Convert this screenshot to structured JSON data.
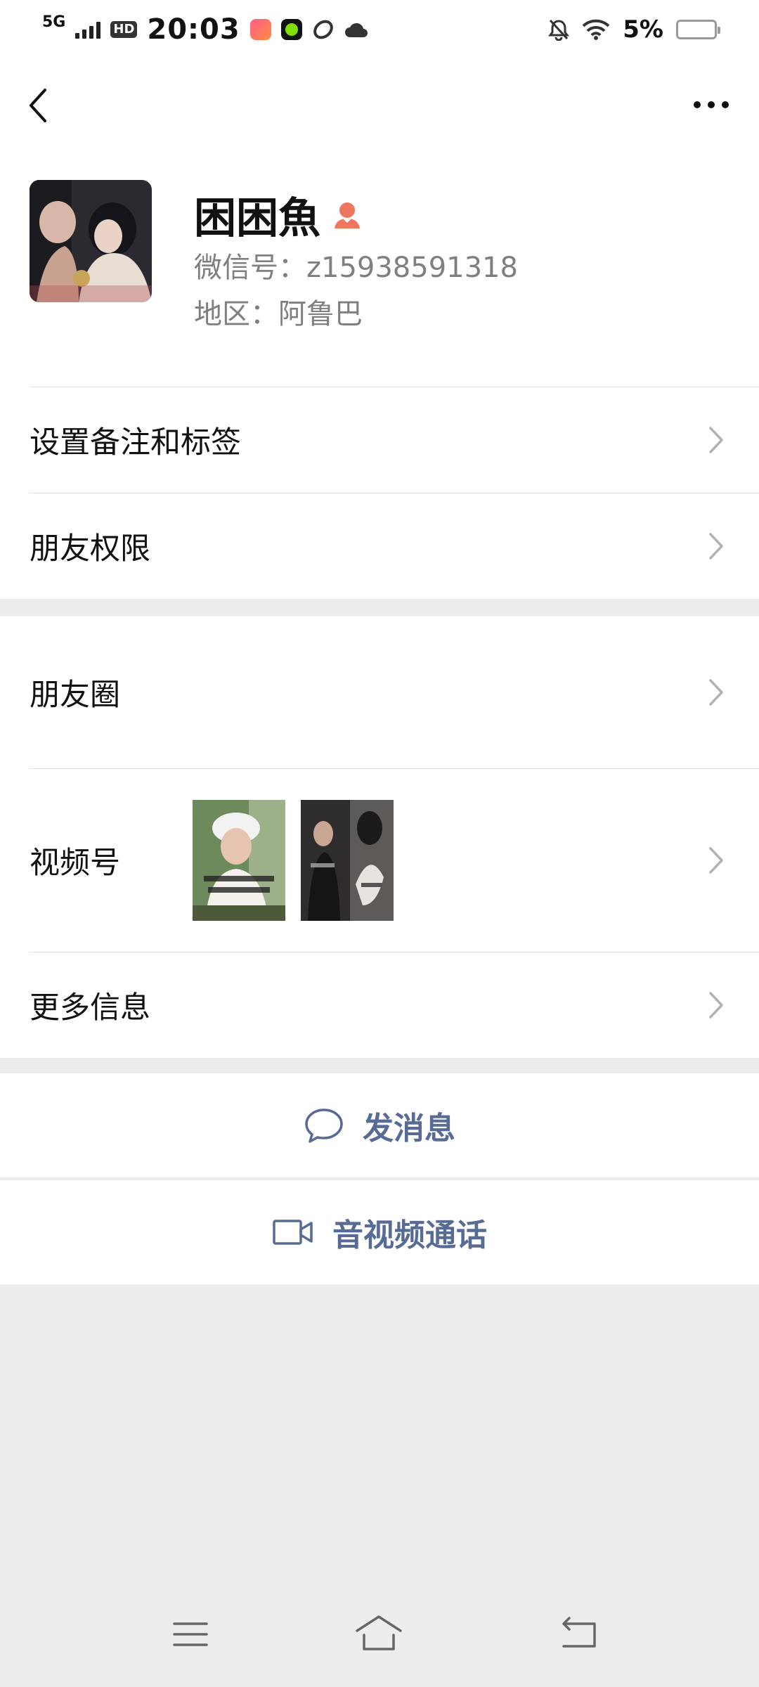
{
  "status_bar": {
    "network": "5G",
    "hd": "HD",
    "time": "20:03",
    "battery_text": "5%",
    "battery_level": 0.05
  },
  "profile": {
    "name": "困困魚",
    "wechat_id": "微信号：z15938591318",
    "region": "地区：阿鲁巴"
  },
  "list": {
    "remark": "设置备注和标签",
    "permissions": "朋友权限",
    "moments": "朋友圈",
    "channels": "视频号",
    "more_info": "更多信息"
  },
  "actions": {
    "message": "发消息",
    "call": "音视频通话"
  },
  "colors": {
    "link": "#576b95",
    "gender_female": "#f0775f",
    "background": "#ededed"
  },
  "icons": [
    "back-arrow-icon",
    "more-dots-icon",
    "female-icon",
    "chevron-right-icon",
    "chat-bubble-icon",
    "video-camera-icon",
    "menu-icon",
    "home-icon",
    "back-icon"
  ]
}
